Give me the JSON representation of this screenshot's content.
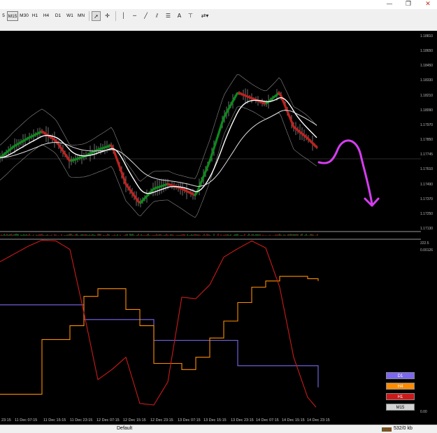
{
  "window": {
    "controls": [
      "—",
      "❐",
      "✕"
    ]
  },
  "toolbar": {
    "timeframes": [
      "5",
      "M15",
      "M30",
      "H1",
      "H4",
      "D1",
      "W1",
      "MN"
    ],
    "active_timeframe": "M15",
    "text_tool": "A"
  },
  "price_axis": [
    "1.18810",
    "1.18650",
    "1.18450",
    "1.18330",
    "1.18210",
    "1.18090",
    "1.17970",
    "1.17850",
    "1.17745",
    "1.17610",
    "1.17490",
    "1.17370",
    "1.17250",
    "1.17130",
    "0.00126"
  ],
  "indicator_axis": [
    "222.5",
    "0.00"
  ],
  "time_axis": [
    "23:15",
    "11 Dec 07:15",
    "11 Dec 15:15",
    "11 Dec 23:15",
    "12 Dec 07:15",
    "12 Dec 15:15",
    "12 Dec 23:15",
    "13 Dec 07:15",
    "13 Dec 15:15",
    "13 Dec 23:15",
    "14 Dec 07:15",
    "14 Dec 15:15",
    "14 Dec 23:15"
  ],
  "legend": [
    {
      "label": "D1",
      "bg": "#7b68ee",
      "fg": "#ffffff"
    },
    {
      "label": "H4",
      "bg": "#ff8c00",
      "fg": "#ffffff"
    },
    {
      "label": "H1",
      "bg": "#cc1a1a",
      "fg": "#ffffff"
    },
    {
      "label": "M15",
      "bg": "#d3d3d3",
      "fg": "#000000"
    }
  ],
  "status": {
    "profile": "Default",
    "traffic": "532/0 kb"
  },
  "colors": {
    "bull": "#0b8a1c",
    "bear": "#c0201e",
    "annotation": "#d53df0",
    "band": "#8a8a8a"
  },
  "chart_data": [
    {
      "type": "line",
      "title": "",
      "note": "main price chart (candles with MA bands)",
      "ylim": [
        1.1713,
        1.1881
      ],
      "x": [
        0,
        20,
        40,
        60,
        80,
        100,
        120,
        140,
        160,
        180,
        200,
        220,
        240,
        260,
        280,
        300,
        320,
        340,
        360,
        380,
        400,
        420,
        440,
        455
      ],
      "series": [
        {
          "name": "price",
          "values": [
            1.1775,
            1.1785,
            1.1792,
            1.1798,
            1.179,
            1.1772,
            1.1776,
            1.1782,
            1.1786,
            1.1752,
            1.1735,
            1.1748,
            1.1752,
            1.1748,
            1.1742,
            1.1772,
            1.181,
            1.1832,
            1.1827,
            1.1822,
            1.1832,
            1.1802,
            1.1792,
            1.1783
          ]
        }
      ]
    },
    {
      "type": "line",
      "title": "",
      "note": "lower step-line oscillator panel",
      "ylim": [
        0,
        222.5
      ],
      "x": [
        0,
        40,
        60,
        80,
        100,
        120,
        140,
        160,
        180,
        200,
        220,
        240,
        260,
        280,
        300,
        320,
        340,
        360,
        380,
        400,
        420,
        440,
        455
      ],
      "series": [
        {
          "name": "D1",
          "values": [
            140,
            140,
            140,
            140,
            140,
            121,
            121,
            121,
            121,
            121,
            94,
            94,
            94,
            94,
            94,
            94,
            61,
            61,
            61,
            61,
            61,
            61,
            33
          ]
        },
        {
          "name": "H4",
          "values": [
            24,
            24,
            95,
            95,
            113,
            151,
            161,
            161,
            134,
            113,
            64,
            64,
            56,
            72,
            97,
            119,
            143,
            163,
            171,
            177,
            177,
            174,
            171
          ]
        },
        {
          "name": "H1",
          "values": [
            196,
            216,
            224,
            223,
            212,
            130,
            43,
            56,
            72,
            12,
            10,
            40,
            150,
            148,
            166,
            202,
            213,
            223,
            214,
            163,
            72,
            20,
            4
          ]
        }
      ]
    }
  ]
}
